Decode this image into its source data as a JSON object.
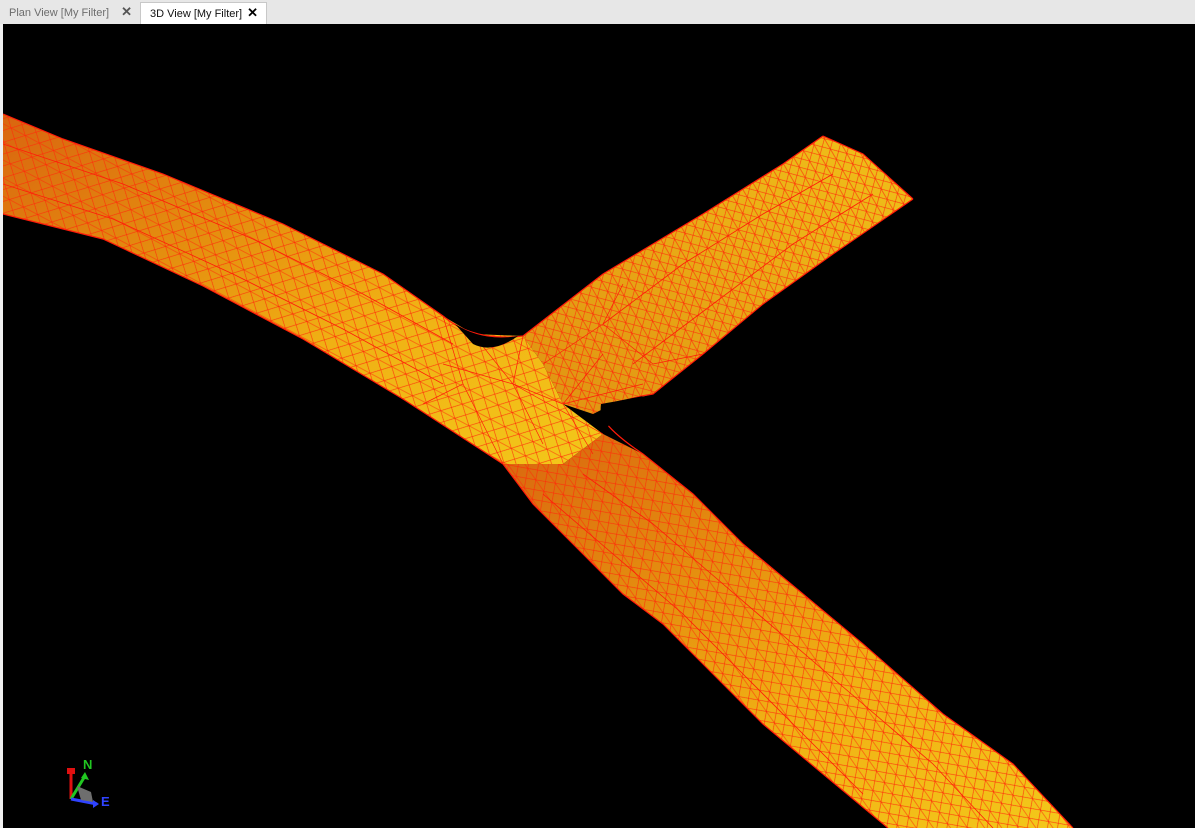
{
  "tabs": [
    {
      "label": "Plan View [My Filter]",
      "active": false,
      "close_icon": "close-icon"
    },
    {
      "label": "3D View [My Filter]",
      "active": true,
      "close_icon": "close-icon"
    }
  ],
  "viewport": {
    "background": "#000000",
    "surface_fill": "#e7a313",
    "mesh_color": "#ff1a0a"
  },
  "axis_indicator": {
    "north_label": "N",
    "east_label": "E",
    "north_color": "#21c721",
    "east_color": "#2f43ff",
    "up_color": "#e01010"
  }
}
